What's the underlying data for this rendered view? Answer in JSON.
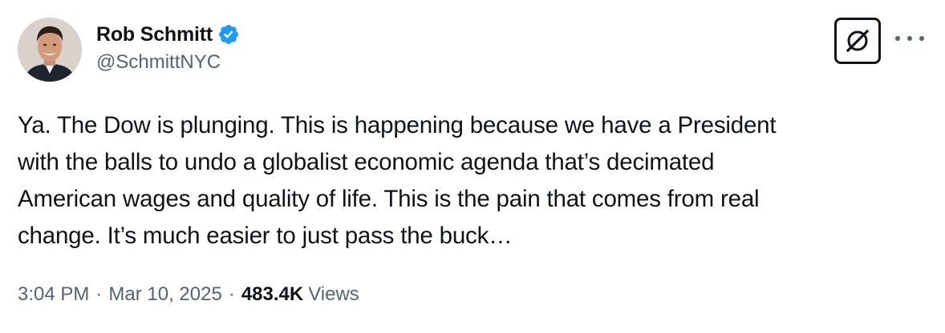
{
  "author": {
    "display_name": "Rob Schmitt",
    "handle": "@SchmittNYC",
    "verified": true,
    "verified_color": "#1d9bf0",
    "avatar_icon": "profile-photo"
  },
  "actions": {
    "grok_icon": "grok-icon",
    "more_icon": "more-options-icon"
  },
  "tweet": {
    "text": "Ya.  The Dow is plunging.  This is happening because we have a President\nwith the balls to undo a globalist economic agenda that’s decimated\nAmerican wages and quality of life.  This is the pain that comes from real\nchange.  It’s much easier to just pass the buck…"
  },
  "meta": {
    "time": "3:04 PM",
    "separator": "·",
    "date": "Mar 10, 2025",
    "views_count": "483.4K",
    "views_label": "Views"
  },
  "colors": {
    "text_primary": "#0f1419",
    "text_secondary": "#536471"
  }
}
